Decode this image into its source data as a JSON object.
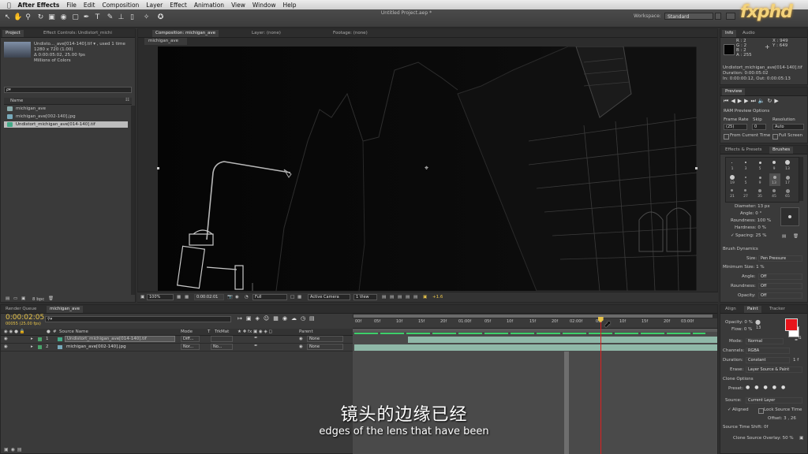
{
  "menubar": {
    "apple": "",
    "app_name": "After Effects",
    "items": [
      "File",
      "Edit",
      "Composition",
      "Layer",
      "Effect",
      "Animation",
      "View",
      "Window",
      "Help"
    ]
  },
  "toolbar": {
    "doc_title": "Untitled Project.aep *",
    "workspace_label": "Workspace:",
    "workspace_value": "Standard"
  },
  "logo": "fxphd",
  "project": {
    "tab_project": "Project",
    "tab_effects": "Effect Controls: Undistort_michi",
    "item_name": "Undisto..._ave[014-140].tif ▾ , used 1 time",
    "item_dims": "1280 x 720 (1.00)",
    "item_dur": "Δ 0:00:05:02, 25.00 fps",
    "item_colors": "Millions of Colors",
    "search_placeholder": "ρ▾",
    "col_name": "Name",
    "items": [
      "michigan_ave",
      "michigan_ave[002-140].jpg",
      "Undistort_michigan_ave[014-140].tif"
    ],
    "bpc": "8 bpc"
  },
  "comp": {
    "tab_comp": "Composition: michigan_ave",
    "tab_layer": "Layer: (none)",
    "tab_footage": "Footage: (none)",
    "sub_tab": "michigan_ave",
    "zoom": "100%",
    "timecode": "0:00:02:01",
    "resolution": "Full",
    "camera": "Active Camera",
    "view": "1 View",
    "exposure": "+1.6"
  },
  "info": {
    "tab_info": "Info",
    "tab_audio": "Audio",
    "r": "R : 2",
    "g": "G : 2",
    "b": "B : 2",
    "a": "A : 255",
    "x": "X : 949",
    "y": "Y : 649",
    "file": "Undistort_michigan_ave[014-140].tif",
    "duration": "Duration: 0:00:05:02",
    "inout": "In: 0:00:00:12, Out: 0:00:05:13"
  },
  "preview": {
    "tab": "Preview",
    "ram_options": "RAM Preview Options",
    "frame_rate_label": "Frame Rate",
    "skip_label": "Skip",
    "resolution_label": "Resolution",
    "frame_rate": "(25)",
    "skip": "0",
    "resolution": "Auto",
    "from_current": "From Current Time",
    "full_screen": "Full Screen"
  },
  "brushes": {
    "tab_effects": "Effects & Presets",
    "tab_brushes": "Brushes",
    "sizes": [
      "1",
      "3",
      "5",
      "9",
      "13",
      "19",
      "5",
      "9",
      "13",
      "17",
      "21",
      "27",
      "35",
      "45",
      "65"
    ],
    "diameter": "Diameter: 13 px",
    "angle": "Angle: 0 °",
    "roundness": "Roundness: 100 %",
    "hardness": "Hardness: 0 %",
    "spacing": "Spacing: 25 %",
    "dynamics": "Brush Dynamics",
    "size_label": "Size:",
    "size_value": "Pen Pressure",
    "min_size": "Minimum Size: 1 %",
    "angle_label": "Angle:",
    "angle_value": "Off",
    "roundness_label": "Roundness:",
    "roundness_value": "Off",
    "opacity_label": "Opacity:",
    "opacity_value": "Off"
  },
  "paint": {
    "tab_align": "Align",
    "tab_paint": "Paint",
    "tab_tracker": "Tracker",
    "opacity": "Opacity: 0 %",
    "flow": "Flow: 0 %",
    "mode_label": "Mode:",
    "mode_value": "Normal",
    "channels_label": "Channels:",
    "channels_value": "RGBA",
    "duration_label": "Duration:",
    "duration_value": "Constant",
    "duration_frames": "1 f",
    "erase_label": "Erase:",
    "erase_value": "Layer Source & Paint",
    "clone_options": "Clone Options",
    "preset_label": "Preset:",
    "source_label": "Source:",
    "source_value": "Current Layer",
    "aligned": "Aligned",
    "lock_source": "Lock Source Time",
    "offset": "Offset: 3 ,   26",
    "source_time_shift": "Source Time Shift: 0f",
    "clone_overlay": "Clone Source Overlay: 50 %",
    "fg_color": "#e8141b",
    "bg_color": "#ffffff"
  },
  "timeline": {
    "tab_render": "Render Queue",
    "tab_comp": "michigan_ave",
    "timecode": "0:00:02:05",
    "fps": "00055 (25.00 fps)",
    "col_num": "#",
    "col_source": "Source Name",
    "col_mode": "Mode",
    "col_t": "T",
    "col_trkmat": "TrkMat",
    "col_parent": "Parent",
    "layers": [
      {
        "num": "1",
        "name": "Undistort_michigan_ave[014-140].tif",
        "mode": "Diff...",
        "trk": "",
        "parent": "None"
      },
      {
        "num": "2",
        "name": "michigan_ave[002-140].jpg",
        "mode": "Nor...",
        "trk": "No...",
        "parent": "None"
      }
    ],
    "ruler": [
      "00f",
      "05f",
      "10f",
      "15f",
      "20f",
      "01:00f",
      "05f",
      "10f",
      "15f",
      "20f",
      "02:00f",
      "05f",
      "10f",
      "15f",
      "20f",
      "03:00f"
    ],
    "current_time_fraction": 0.697
  },
  "subtitles": {
    "zh": "镜头的边缘已经",
    "en": "edges of the lens that have been"
  }
}
